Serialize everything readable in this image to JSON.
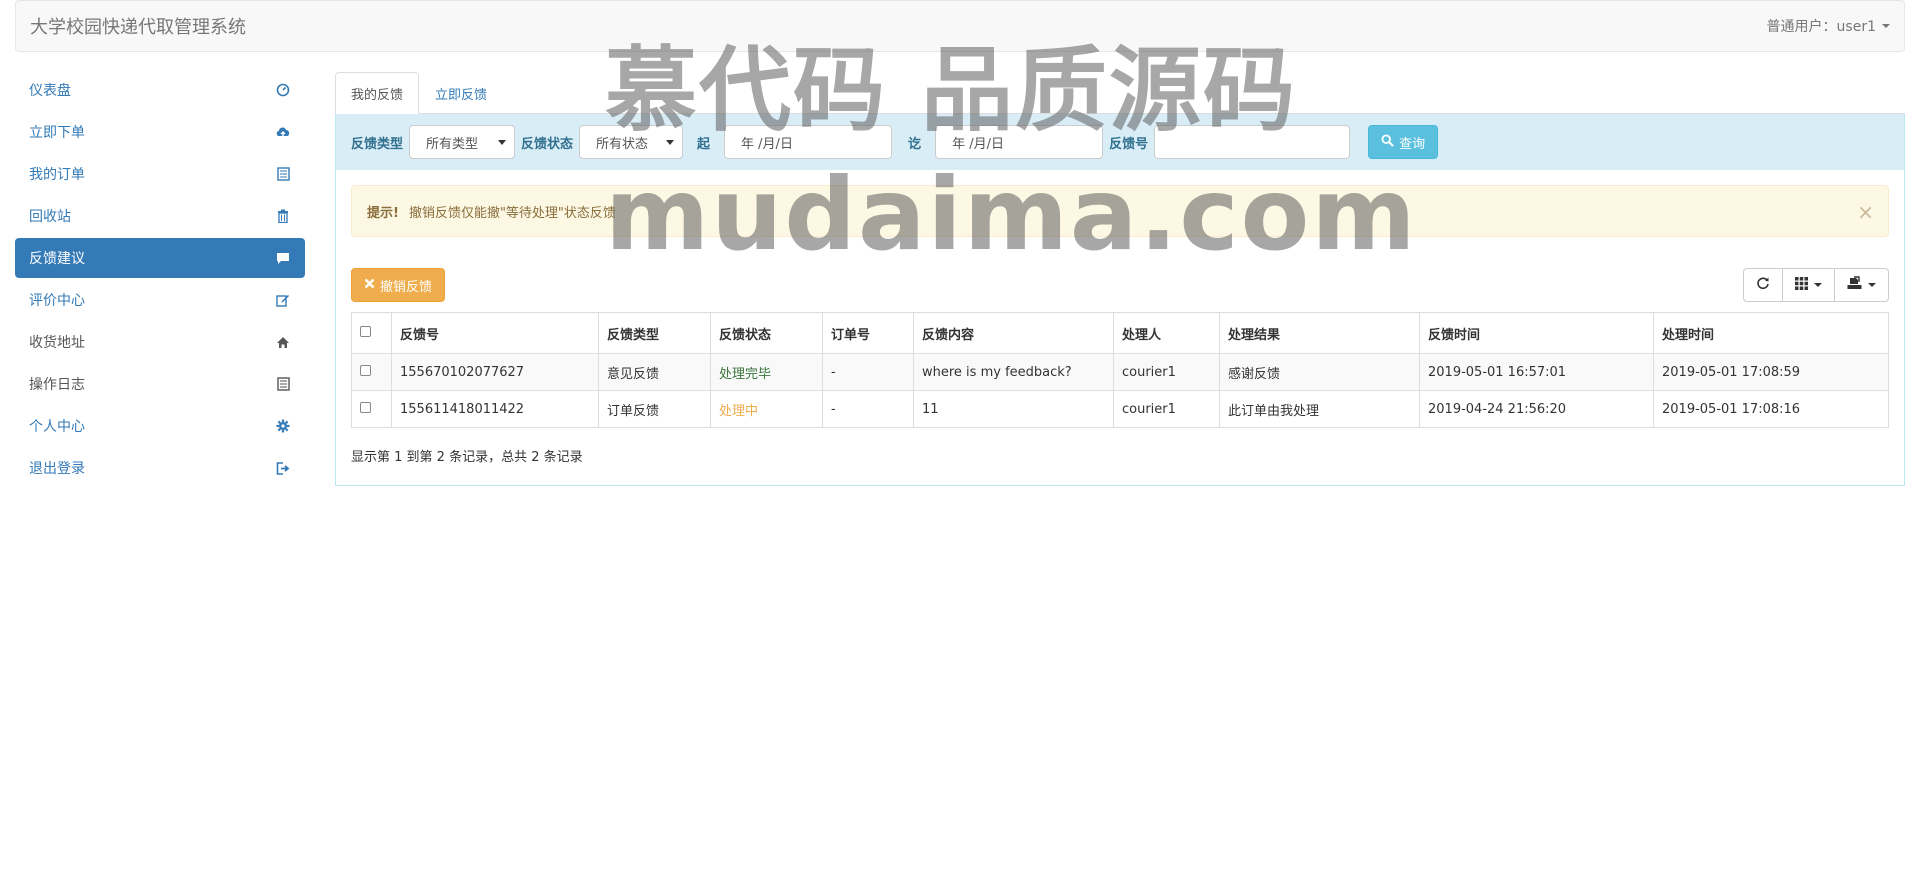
{
  "navbar": {
    "brand": "大学校园快递代取管理系统",
    "user_label": "普通用户：user1"
  },
  "sidebar": {
    "items": [
      {
        "label": "仪表盘",
        "icon": "dashboard-icon"
      },
      {
        "label": "立即下单",
        "icon": "cloud-upload-icon"
      },
      {
        "label": "我的订单",
        "icon": "list-alt-icon"
      },
      {
        "label": "回收站",
        "icon": "trash-icon"
      },
      {
        "label": "反馈建议",
        "icon": "comment-icon",
        "active": true
      },
      {
        "label": "评价中心",
        "icon": "edit-icon"
      },
      {
        "label": "收货地址",
        "icon": "home-icon"
      },
      {
        "label": "操作日志",
        "icon": "list-alt-icon"
      },
      {
        "label": "个人中心",
        "icon": "cog-icon"
      },
      {
        "label": "退出登录",
        "icon": "log-out-icon"
      }
    ]
  },
  "tabs": [
    {
      "label": "我的反馈",
      "active": true
    },
    {
      "label": "立即反馈",
      "active": false
    }
  ],
  "filter": {
    "type_label": "反馈类型",
    "type_value": "所有类型",
    "status_label": "反馈状态",
    "status_value": "所有状态",
    "start_label": "起",
    "start_placeholder": "年 /月/日",
    "end_label": "讫",
    "end_placeholder": "年 /月/日",
    "id_label": "反馈号",
    "id_value": "",
    "query_button": "查询"
  },
  "alert": {
    "title": "提示!",
    "message": "撤销反馈仅能撤\"等待处理\"状态反馈",
    "close": "×"
  },
  "toolbar": {
    "cancel_button": "撤销反馈"
  },
  "table": {
    "headers": [
      "反馈号",
      "反馈类型",
      "反馈状态",
      "订单号",
      "反馈内容",
      "处理人",
      "处理结果",
      "反馈时间",
      "处理时间"
    ],
    "rows": [
      [
        "155670102077627",
        "意见反馈",
        "处理完毕",
        "-",
        "where is my feedback?",
        "courier1",
        "感谢反馈",
        "2019-05-01 16:57:01",
        "2019-05-01 17:08:59"
      ],
      [
        "155611418011422",
        "订单反馈",
        "处理中",
        "-",
        "11",
        "courier1",
        "此订单由我处理",
        "2019-04-24 21:56:20",
        "2019-05-01 17:08:16"
      ]
    ]
  },
  "pagination": {
    "info": "显示第 1 到第 2 条记录，总共 2 条记录"
  },
  "watermark": {
    "line1": "慕代码 品质源码",
    "line2": "mudaima.com"
  },
  "colors": {
    "primary": "#337ab7",
    "info": "#5bc0de",
    "warning": "#f0ad4e",
    "success_text": "#3c763d"
  }
}
